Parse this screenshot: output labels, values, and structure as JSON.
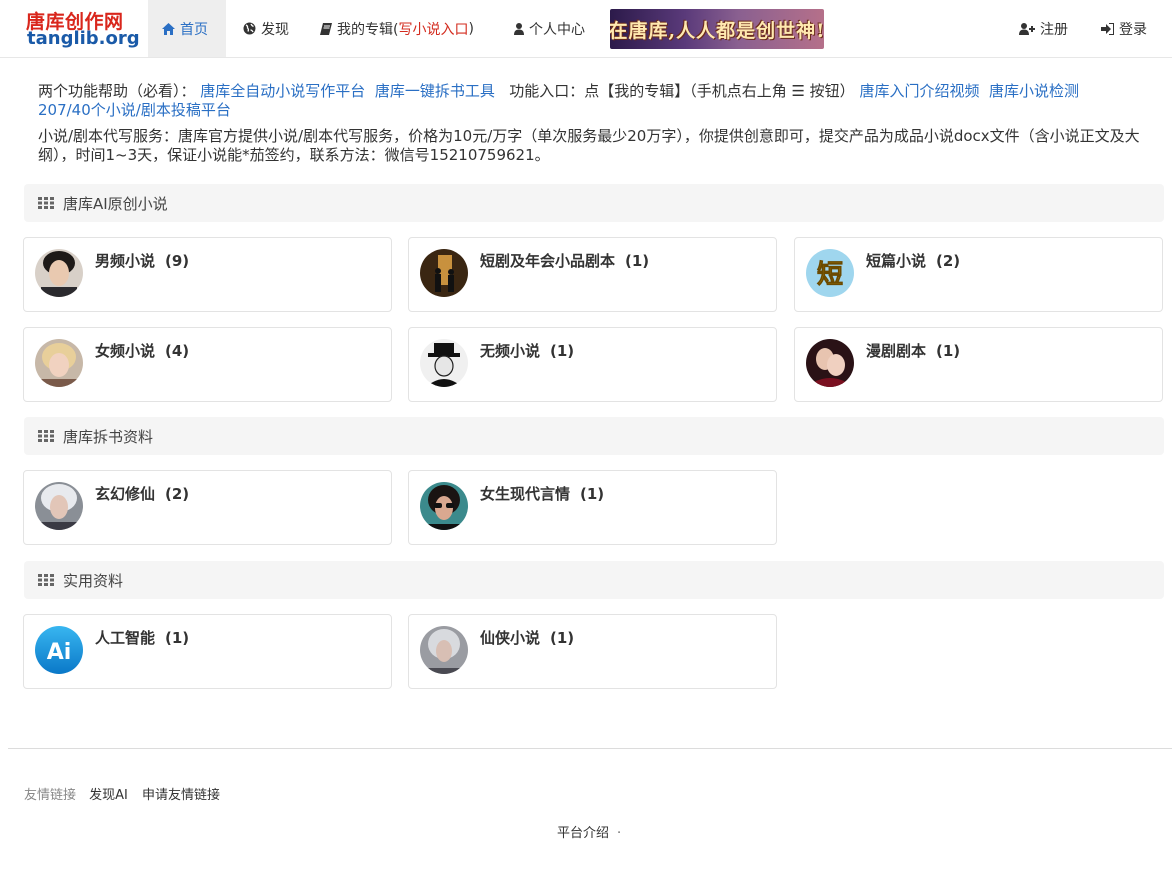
{
  "brand": {
    "cn": "唐库创作网",
    "en": "tanglib.org"
  },
  "nav": {
    "home": "首页",
    "discover": "发现",
    "special_prefix": "我的专辑(",
    "special_red": "写小说入口",
    "special_suffix": ")",
    "center": "个人中心",
    "register": "注册",
    "login": "登录"
  },
  "banner": {
    "text": "在唐库,人人都是创世神!"
  },
  "notice": {
    "help_prefix": "两个功能帮助（必看）：",
    "link_platform": "唐库全自动小说写作平台",
    "link_split": "唐库一键拆书工具",
    "entry_text": "功能入口：点【我的专辑】（手机点右上角 ☰ 按钮）",
    "link_intro": "唐库入门介绍视频",
    "link_check": "唐库小说检测",
    "link_submit": "207/40个小说/剧本投稿平台",
    "service": "小说/剧本代写服务：唐库官方提供小说/剧本代写服务，价格为10元/万字（单次服务最少20万字），你提供创意即可，提交产品为成品小说docx文件（含小说正文及大纲），时间1~3天，保证小说能*茄签约，联系方法：微信号15210759621。"
  },
  "sections": [
    {
      "title": "唐库AI原创小说",
      "cards": [
        {
          "name": "男频小说",
          "count": "(9)"
        },
        {
          "name": "短剧及年会小品剧本",
          "count": "(1)"
        },
        {
          "name": "短篇小说",
          "count": "(2)"
        },
        {
          "name": "女频小说",
          "count": "(4)"
        },
        {
          "name": "无频小说",
          "count": "(1)"
        },
        {
          "name": "漫剧剧本",
          "count": "(1)"
        }
      ]
    },
    {
      "title": "唐库拆书资料",
      "cards": [
        {
          "name": "玄幻修仙",
          "count": "(2)"
        },
        {
          "name": "女生现代言情",
          "count": "(1)"
        }
      ]
    },
    {
      "title": "实用资料",
      "cards": [
        {
          "name": "人工智能",
          "count": "(1)"
        },
        {
          "name": "仙侠小说",
          "count": "(1)"
        }
      ]
    }
  ],
  "avatar_glyphs": {
    "short": "短",
    "ai": "Ai"
  },
  "footer": {
    "links_label": "友情链接",
    "link_discover_ai": "发现AI",
    "link_apply": "申请友情链接",
    "platform_intro": "平台介绍",
    "dot": "·"
  },
  "colors": {
    "accent": "#2a6fc4",
    "brand_red": "#d9261c",
    "brand_blue": "#1a5aa8",
    "highlight_red": "#d32b1e"
  },
  "icons": {
    "home": "home-icon",
    "discover": "globe-icon",
    "special": "book-icon",
    "center": "user-icon",
    "register": "user-plus-icon",
    "login": "sign-in-icon",
    "section": "grid-icon",
    "menu": "hamburger-icon"
  }
}
